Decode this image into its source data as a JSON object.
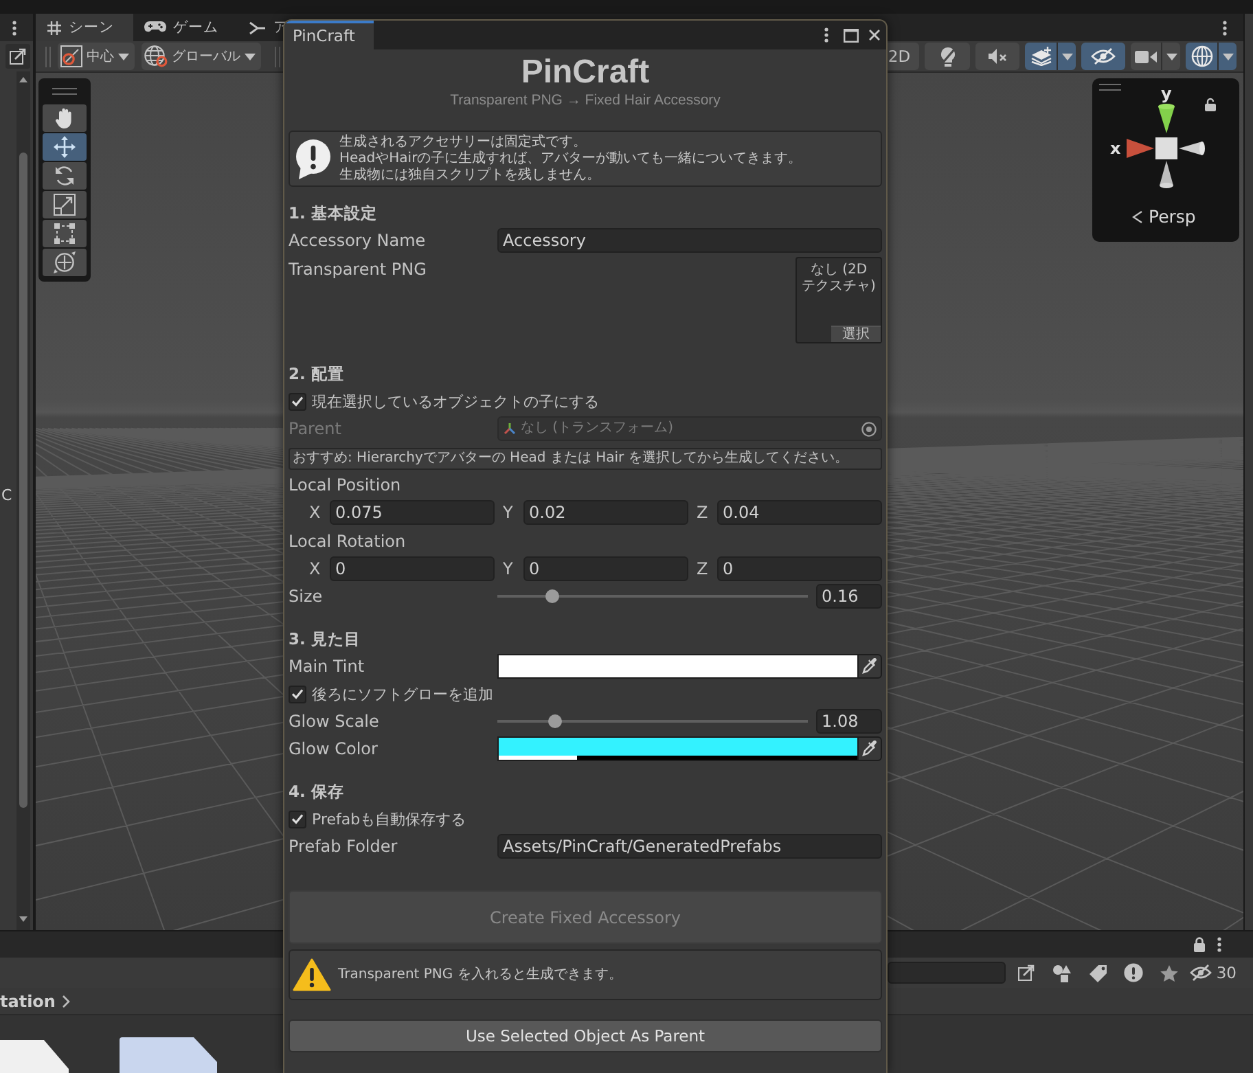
{
  "hierarchy_panel": {
    "text": "C"
  },
  "scene_view": {
    "tabs": [
      {
        "kind": "scene",
        "label": "シーン",
        "selected": true
      },
      {
        "kind": "game",
        "label": "ゲーム",
        "selected": false
      },
      {
        "kind": "animator",
        "label": "ア",
        "selected": false
      }
    ],
    "pivot_dropdown": "中心",
    "space_dropdown": "グローバル",
    "view_toggles": [
      {
        "kind": "dimension",
        "label": "2D",
        "on": false,
        "dropdown": false
      },
      {
        "kind": "lighting",
        "on": false,
        "dropdown": false
      },
      {
        "kind": "audio",
        "on": false,
        "dropdown": false
      },
      {
        "kind": "effects",
        "on": true,
        "dropdown": true
      },
      {
        "kind": "visibility",
        "on": true,
        "dropdown": false
      },
      {
        "kind": "camera",
        "on": false,
        "dropdown": true
      },
      {
        "kind": "gizmos",
        "on": true,
        "dropdown": true
      }
    ],
    "tools": [
      {
        "kind": "hand",
        "selected": false
      },
      {
        "kind": "move",
        "selected": true
      },
      {
        "kind": "rotate",
        "selected": false
      },
      {
        "kind": "scale",
        "selected": false
      },
      {
        "kind": "rect",
        "selected": false
      },
      {
        "kind": "transform",
        "selected": false
      }
    ],
    "orientation_gizmo": {
      "y_label": "y",
      "x_label": "x",
      "projection": "Persp"
    }
  },
  "window": {
    "tab": "PinCraft",
    "title": "PinCraft",
    "subtitle": "Transparent PNG → Fixed Hair Accessory",
    "info": [
      "生成されるアクセサリーは固定式です。",
      "HeadやHairの子に生成すれば、アバターが動いても一緒についてきます。",
      "生成物には独自スクリプトを残しません。"
    ],
    "sections": [
      {
        "heading": "1. 基本設定",
        "rows": [
          {
            "kind": "text",
            "label": "Accessory Name",
            "value": "Accessory"
          },
          {
            "kind": "texture",
            "label": "Transparent PNG",
            "value": "なし (2D テクスチャ)",
            "button": "選択"
          }
        ]
      },
      {
        "heading": "2. 配置",
        "rows": [
          {
            "kind": "toggle",
            "label": "現在選択しているオブジェクトの子にする",
            "checked": true
          },
          {
            "kind": "object",
            "label": "Parent",
            "value": "なし (トランスフォーム)",
            "disabled": true
          },
          {
            "kind": "note",
            "text": "おすすめ: Hierarchyでアバターの Head または Hair を選択してから生成してください。"
          },
          {
            "kind": "vector",
            "label": "Local Position",
            "axes": [
              {
                "axis": "X",
                "value": "0.075"
              },
              {
                "axis": "Y",
                "value": "0.02"
              },
              {
                "axis": "Z",
                "value": "0.04"
              }
            ]
          },
          {
            "kind": "vector",
            "label": "Local Rotation",
            "axes": [
              {
                "axis": "X",
                "value": "0"
              },
              {
                "axis": "Y",
                "value": "0"
              },
              {
                "axis": "Z",
                "value": "0"
              }
            ]
          },
          {
            "kind": "slider",
            "label": "Size",
            "level": 0.16,
            "value": "0.16"
          }
        ]
      },
      {
        "heading": "3. 見た目",
        "rows": [
          {
            "kind": "color",
            "label": "Main Tint",
            "color": "#ffffff",
            "level": 1
          },
          {
            "kind": "toggle",
            "label": "後ろにソフトグローを追加",
            "checked": true
          },
          {
            "kind": "slider",
            "label": "Glow Scale",
            "level": 0.17,
            "value": "1.08"
          },
          {
            "kind": "color",
            "label": "Glow Color",
            "color": "#33f2ff",
            "level": 0.22
          }
        ]
      },
      {
        "heading": "4. 保存",
        "rows": [
          {
            "kind": "toggle",
            "label": "Prefabも自動保存する",
            "checked": true
          },
          {
            "kind": "text",
            "label": "Prefab Folder",
            "value": "Assets/PinCraft/GeneratedPrefabs"
          }
        ]
      }
    ],
    "create_button": {
      "label": "Create Fixed Accessory",
      "disabled": true
    },
    "warning": "Transparent PNG を入れると生成できます。",
    "parent_button": "Use Selected Object As Parent"
  },
  "project_panel": {
    "breadcrumb": "tation",
    "hidden_count": "30"
  }
}
